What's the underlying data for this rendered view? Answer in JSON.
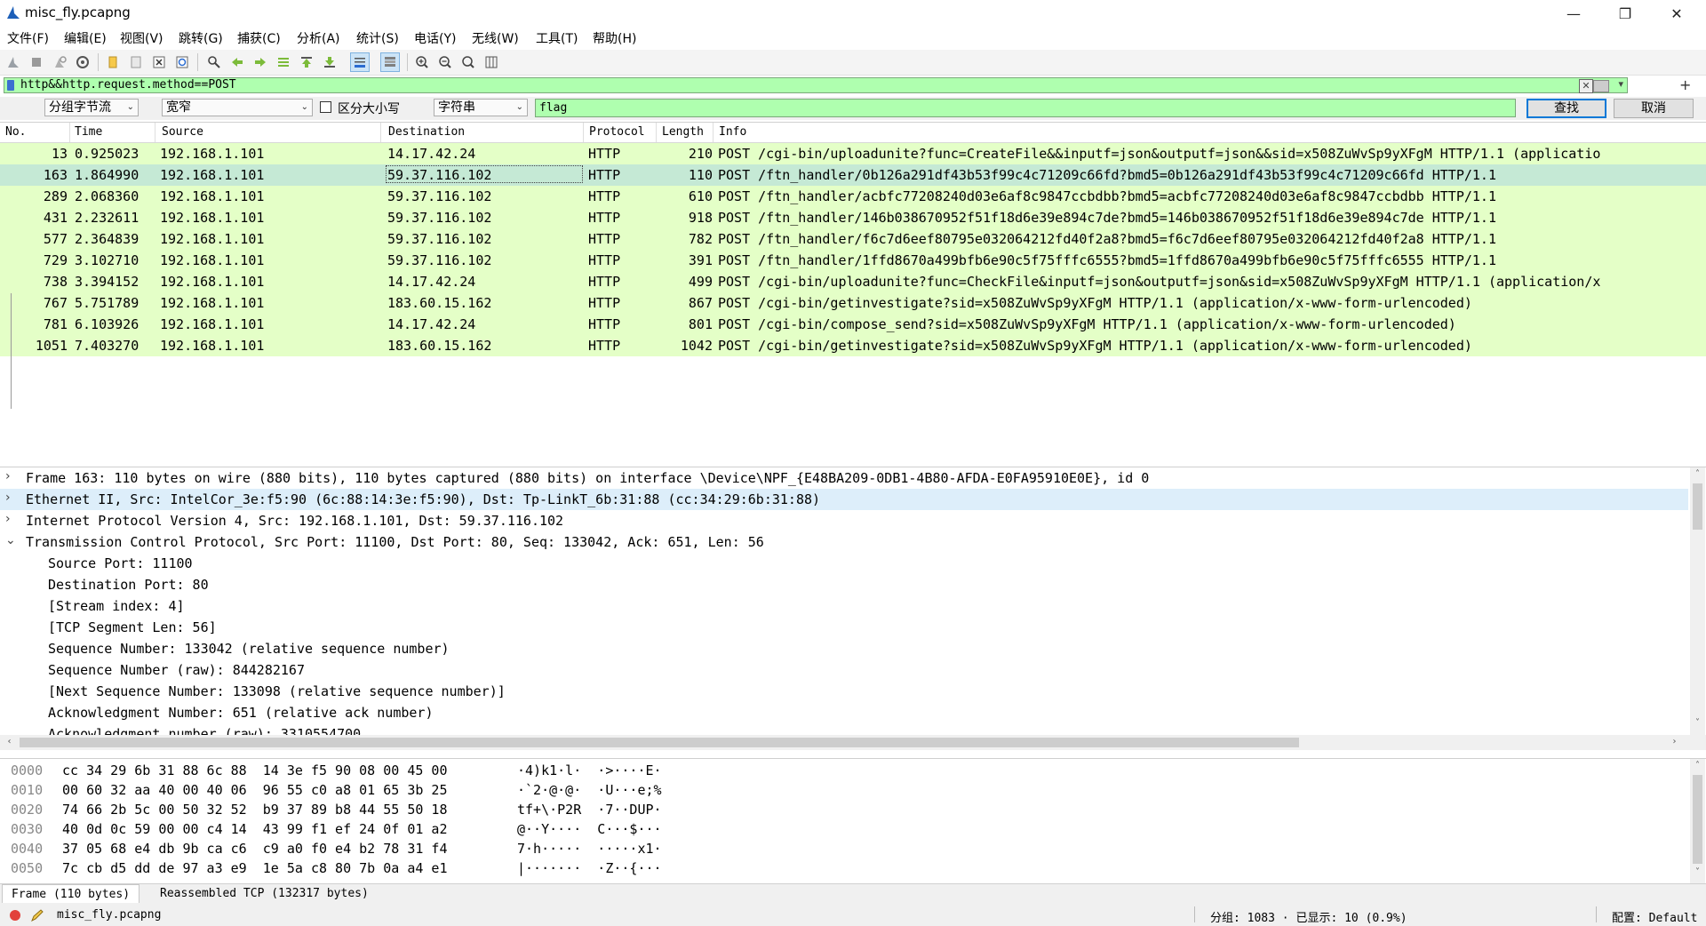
{
  "window": {
    "title": "misc_fly.pcapng",
    "minimize": "—",
    "restore": "❐",
    "close": "✕"
  },
  "menu": [
    "文件(F)",
    "编辑(E)",
    "视图(V)",
    "跳转(G)",
    "捕获(C)",
    "分析(A)",
    "统计(S)",
    "电话(Y)",
    "无线(W)",
    "工具(T)",
    "帮助(H)"
  ],
  "toolbar_icons": [
    "shark-fin-start-icon",
    "stop-capture-icon",
    "restart-capture-icon",
    "capture-options-icon",
    "open-file-icon",
    "save-file-icon",
    "close-file-icon",
    "reload-file-icon",
    "find-packet-icon",
    "go-back-icon",
    "go-forward-icon",
    "go-to-packet-icon",
    "go-first-icon",
    "go-last-icon",
    "auto-scroll-icon",
    "colorize-icon",
    "zoom-in-icon",
    "zoom-out-icon",
    "zoom-normal-icon",
    "resize-columns-icon"
  ],
  "display_filter": {
    "value": "http&&http.request.method==POST"
  },
  "find": {
    "search_in": "分组字节流",
    "char_width": "宽窄",
    "case_sensitive_label": "区分大小写",
    "type": "字符串",
    "value": "flag",
    "find_label": "查找",
    "cancel_label": "取消"
  },
  "packet_list": {
    "columns": [
      "No.",
      "Time",
      "Source",
      "Destination",
      "Protocol",
      "Length",
      "Info"
    ],
    "rows": [
      {
        "no": "13",
        "time": "0.925023",
        "src": "192.168.1.101",
        "dst": "14.17.42.24",
        "proto": "HTTP",
        "len": "210",
        "info": "POST /cgi-bin/uploadunite?func=CreateFile&&inputf=json&outputf=json&&sid=x508ZuWvSp9yXFgM HTTP/1.1  (applicatio"
      },
      {
        "no": "163",
        "time": "1.864990",
        "src": "192.168.1.101",
        "dst": "59.37.116.102",
        "proto": "HTTP",
        "len": "110",
        "info": "POST /ftn_handler/0b126a291df43b53f99c4c71209c66fd?bmd5=0b126a291df43b53f99c4c71209c66fd HTTP/1.1"
      },
      {
        "no": "289",
        "time": "2.068360",
        "src": "192.168.1.101",
        "dst": "59.37.116.102",
        "proto": "HTTP",
        "len": "610",
        "info": "POST /ftn_handler/acbfc77208240d03e6af8c9847ccbdbb?bmd5=acbfc77208240d03e6af8c9847ccbdbb HTTP/1.1"
      },
      {
        "no": "431",
        "time": "2.232611",
        "src": "192.168.1.101",
        "dst": "59.37.116.102",
        "proto": "HTTP",
        "len": "918",
        "info": "POST /ftn_handler/146b038670952f51f18d6e39e894c7de?bmd5=146b038670952f51f18d6e39e894c7de HTTP/1.1"
      },
      {
        "no": "577",
        "time": "2.364839",
        "src": "192.168.1.101",
        "dst": "59.37.116.102",
        "proto": "HTTP",
        "len": "782",
        "info": "POST /ftn_handler/f6c7d6eef80795e032064212fd40f2a8?bmd5=f6c7d6eef80795e032064212fd40f2a8 HTTP/1.1"
      },
      {
        "no": "729",
        "time": "3.102710",
        "src": "192.168.1.101",
        "dst": "59.37.116.102",
        "proto": "HTTP",
        "len": "391",
        "info": "POST /ftn_handler/1ffd8670a499bfb6e90c5f75fffc6555?bmd5=1ffd8670a499bfb6e90c5f75fffc6555 HTTP/1.1"
      },
      {
        "no": "738",
        "time": "3.394152",
        "src": "192.168.1.101",
        "dst": "14.17.42.24",
        "proto": "HTTP",
        "len": "499",
        "info": "POST /cgi-bin/uploadunite?func=CheckFile&inputf=json&outputf=json&sid=x508ZuWvSp9yXFgM HTTP/1.1  (application/x"
      },
      {
        "no": "767",
        "time": "5.751789",
        "src": "192.168.1.101",
        "dst": "183.60.15.162",
        "proto": "HTTP",
        "len": "867",
        "info": "POST /cgi-bin/getinvestigate?sid=x508ZuWvSp9yXFgM HTTP/1.1  (application/x-www-form-urlencoded)"
      },
      {
        "no": "781",
        "time": "6.103926",
        "src": "192.168.1.101",
        "dst": "14.17.42.24",
        "proto": "HTTP",
        "len": "801",
        "info": "POST /cgi-bin/compose_send?sid=x508ZuWvSp9yXFgM HTTP/1.1  (application/x-www-form-urlencoded)"
      },
      {
        "no": "1051",
        "time": "7.403270",
        "src": "192.168.1.101",
        "dst": "183.60.15.162",
        "proto": "HTTP",
        "len": "1042",
        "info": "POST /cgi-bin/getinvestigate?sid=x508ZuWvSp9yXFgM HTTP/1.1  (application/x-www-form-urlencoded)"
      }
    ]
  },
  "details": [
    {
      "exp": ">",
      "indent": 0,
      "text": "Frame 163: 110 bytes on wire (880 bits), 110 bytes captured (880 bits) on interface \\Device\\NPF_{E48BA209-0DB1-4B80-AFDA-E0FA95910E0E}, id 0"
    },
    {
      "exp": ">",
      "indent": 0,
      "text": "Ethernet II, Src: IntelCor_3e:f5:90 (6c:88:14:3e:f5:90), Dst: Tp-LinkT_6b:31:88 (cc:34:29:6b:31:88)"
    },
    {
      "exp": ">",
      "indent": 0,
      "text": "Internet Protocol Version 4, Src: 192.168.1.101, Dst: 59.37.116.102"
    },
    {
      "exp": "v",
      "indent": 0,
      "text": "Transmission Control Protocol, Src Port: 11100, Dst Port: 80, Seq: 133042, Ack: 651, Len: 56"
    },
    {
      "exp": "",
      "indent": 1,
      "text": "Source Port: 11100"
    },
    {
      "exp": "",
      "indent": 1,
      "text": "Destination Port: 80"
    },
    {
      "exp": "",
      "indent": 1,
      "text": "[Stream index: 4]"
    },
    {
      "exp": "",
      "indent": 1,
      "text": "[TCP Segment Len: 56]"
    },
    {
      "exp": "",
      "indent": 1,
      "text": "Sequence Number: 133042    (relative sequence number)"
    },
    {
      "exp": "",
      "indent": 1,
      "text": "Sequence Number (raw): 844282167"
    },
    {
      "exp": "",
      "indent": 1,
      "text": "[Next Sequence Number: 133098    (relative sequence number)]"
    },
    {
      "exp": "",
      "indent": 1,
      "text": "Acknowledgment Number: 651    (relative ack number)"
    },
    {
      "exp": "",
      "indent": 1,
      "text": "Acknowledgment number (raw): 3310554700"
    }
  ],
  "hex": [
    {
      "off": "0000",
      "hex": "cc 34 29 6b 31 88 6c 88  14 3e f5 90 08 00 45 00",
      "ascii": "·4)k1·l·  ·>····E·"
    },
    {
      "off": "0010",
      "hex": "00 60 32 aa 40 00 40 06  96 55 c0 a8 01 65 3b 25",
      "ascii": "·`2·@·@·  ·U···e;%"
    },
    {
      "off": "0020",
      "hex": "74 66 2b 5c 00 50 32 52  b9 37 89 b8 44 55 50 18",
      "ascii": "tf+\\·P2R  ·7··DUP·"
    },
    {
      "off": "0030",
      "hex": "40 0d 0c 59 00 00 c4 14  43 99 f1 ef 24 0f 01 a2",
      "ascii": "@··Y····  C···$···"
    },
    {
      "off": "0040",
      "hex": "37 05 68 e4 db 9b ca c6  c9 a0 f0 e4 b2 78 31 f4",
      "ascii": "7·h·····  ·····x1·"
    },
    {
      "off": "0050",
      "hex": "7c cb d5 dd de 97 a3 e9  1e 5a c8 80 7b 0a a4 e1",
      "ascii": "|·······  ·Z··{···"
    }
  ],
  "byte_tabs": [
    "Frame (110 bytes)",
    "Reassembled TCP (132317 bytes)"
  ],
  "status": {
    "file": "misc_fly.pcapng",
    "packets": "分组: 1083 · 已显示: 10 (0.9%)",
    "profile": "配置: Default"
  },
  "colors": {
    "row_bg": "#e4ffc7",
    "selected_row_bg": "#c5e9d5",
    "filter_bg": "#afffaf",
    "detail_highlight": "#ddeefa"
  }
}
